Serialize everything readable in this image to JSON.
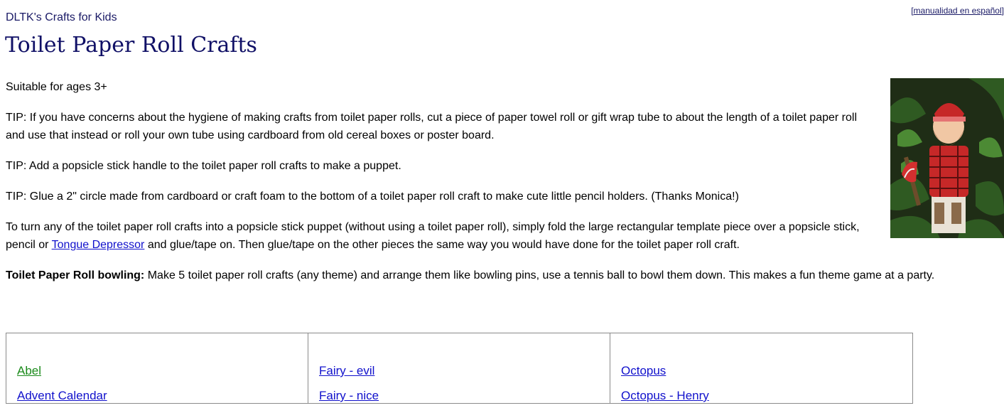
{
  "header": {
    "site_name": "DLTK's Crafts for Kids",
    "language_link": "manualidad en español",
    "page_title": "Toilet Paper Roll Crafts"
  },
  "content": {
    "ages": "Suitable for ages 3+",
    "tip1": "TIP:  If you have concerns about the hygiene of making crafts from toilet paper rolls, cut a piece of paper towel roll or gift wrap tube to about the length of a toilet paper roll and use that instead or roll your own tube using cardboard from old cereal boxes or poster board.",
    "tip2": "TIP:  Add a popsicle stick handle to the toilet paper roll crafts to make a puppet.",
    "tip3": "TIP:  Glue a 2\" circle made from cardboard or craft foam to the bottom of a toilet paper roll craft to make cute little pencil holders.  (Thanks Monica!)",
    "puppet_before": "To turn any of the toilet paper roll crafts into a popsicle stick puppet (without using a toilet paper roll), simply fold the large rectangular template piece over a popsicle stick, pencil or ",
    "puppet_link": "Tongue Depressor",
    "puppet_after": " and glue/tape on.  Then glue/tape on the other pieces the same way you would have done for the toilet paper roll craft.",
    "bowling_label": "Toilet Paper Roll bowling:",
    "bowling_text": "  Make 5 toilet paper roll crafts (any theme) and arrange them like bowling pins, use a tennis ball to bowl them down.  This makes a fun theme game at a party."
  },
  "photo": {
    "alt": "lumberjack toilet paper roll craft photo"
  },
  "craft_columns": [
    [
      "Abel",
      "Advent Calendar"
    ],
    [
      "Fairy - evil",
      "Fairy - nice"
    ],
    [
      "Octopus",
      "Octopus - Henry"
    ]
  ]
}
